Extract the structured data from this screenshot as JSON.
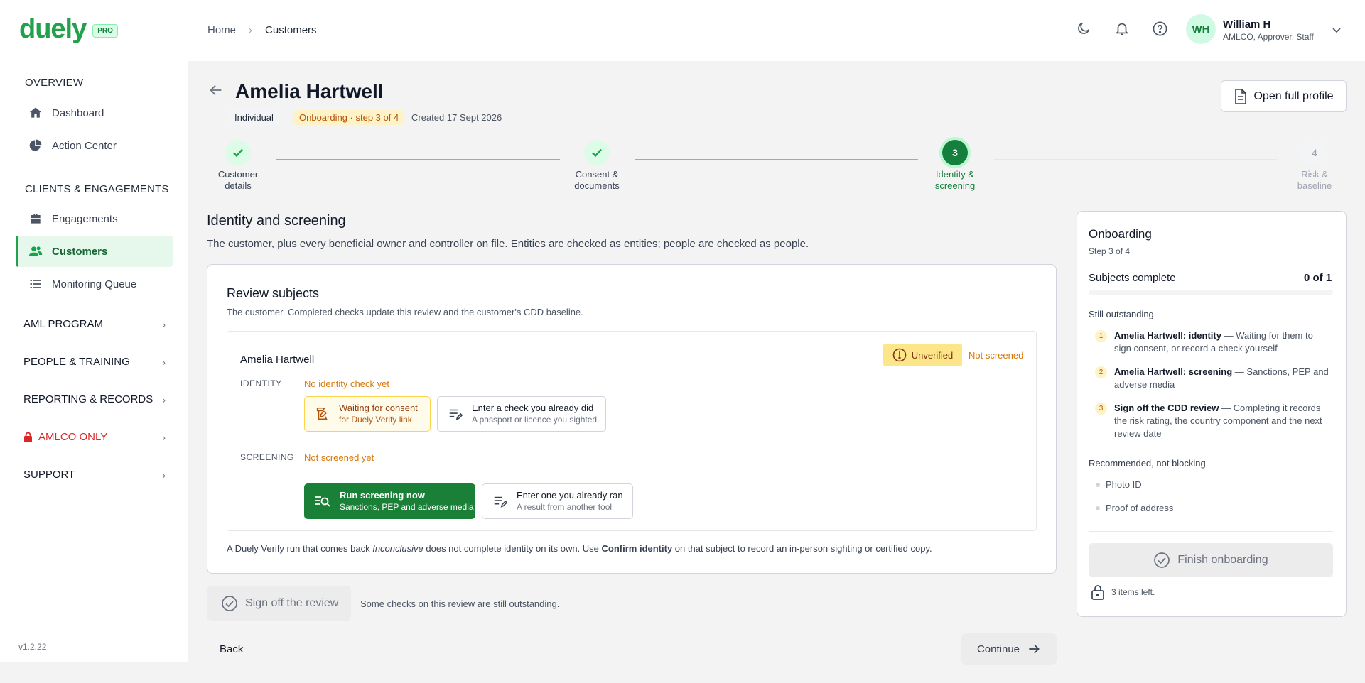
{
  "app": {
    "logo": "duely",
    "badge": "PRO",
    "version": "v1.2.22"
  },
  "sidebar": {
    "overview_title": "OVERVIEW",
    "overview_items": [
      {
        "label": "Dashboard",
        "icon": "home-icon"
      },
      {
        "label": "Action Center",
        "icon": "pie-chart-icon"
      }
    ],
    "clients_title": "CLIENTS & ENGAGEMENTS",
    "clients_items": [
      {
        "label": "Engagements",
        "icon": "briefcase-icon"
      },
      {
        "label": "Customers",
        "icon": "users-icon"
      },
      {
        "label": "Monitoring Queue",
        "icon": "checklist-icon"
      }
    ],
    "groups": [
      {
        "label": "AML PROGRAM"
      },
      {
        "label": "PEOPLE & TRAINING"
      },
      {
        "label": "REPORTING & RECORDS"
      },
      {
        "label": "AMLCO ONLY"
      },
      {
        "label": "SUPPORT"
      }
    ]
  },
  "header": {
    "breadcrumb": [
      "Home",
      "Customers"
    ],
    "user": {
      "initials": "WH",
      "name": "William H",
      "role": "AMLCO, Approver, Staff"
    }
  },
  "customer": {
    "name": "Amelia Hartwell",
    "type": "Individual",
    "status": "Onboarding · step 3 of 4",
    "created": "Created 17 Sept 2026",
    "open_profile": "Open full profile"
  },
  "stepper": [
    {
      "num": "1",
      "line1": "Customer",
      "line2": "details",
      "state": "done"
    },
    {
      "num": "2",
      "line1": "Consent &",
      "line2": "documents",
      "state": "done"
    },
    {
      "num": "3",
      "line1": "Identity &",
      "line2": "screening",
      "state": "current"
    },
    {
      "num": "4",
      "line1": "Risk &",
      "line2": "baseline",
      "state": "upcoming"
    }
  ],
  "section": {
    "title": "Identity and screening",
    "description": "The customer, plus every beneficial owner and controller on file. Entities are checked as entities; people are checked as people."
  },
  "review": {
    "title": "Review subjects",
    "description": "The customer. Completed checks update this review and the customer's CDD baseline.",
    "subject": {
      "name": "Amelia Hartwell",
      "badge": "Unverified",
      "screen_status": "Not screened"
    },
    "identity": {
      "label": "IDENTITY",
      "status": "No identity check yet",
      "consent_title": "Waiting for consent",
      "consent_sub": "for Duely Verify link",
      "enter_title": "Enter a check you already did",
      "enter_sub": "A passport or licence you sighted"
    },
    "screening": {
      "label": "SCREENING",
      "status": "Not screened yet",
      "run_title": "Run screening now",
      "run_sub": "Sanctions, PEP and adverse media",
      "enter_title": "Enter one you already ran",
      "enter_sub": "A result from another tool"
    },
    "footnote_a": "A Duely Verify run that comes back ",
    "footnote_b": "Inconclusive",
    "footnote_c": " does not complete identity on its own. Use ",
    "footnote_d": "Confirm identity",
    "footnote_e": " on that subject to record an in-person sighting or certified copy."
  },
  "signoff": {
    "button": "Sign off the review",
    "note": "Some checks on this review are still outstanding."
  },
  "footer": {
    "back": "Back",
    "continue": "Continue"
  },
  "panel": {
    "title": "Onboarding",
    "step": "Step 3 of 4",
    "progress_label": "Subjects complete",
    "progress_value": "0 of 1",
    "progress_fraction": 0,
    "outstanding_title": "Still outstanding",
    "outstanding": [
      {
        "num": "1",
        "bold": "Amelia Hartwell: identity",
        "rest": " — Waiting for them to sign consent, or record a check yourself"
      },
      {
        "num": "2",
        "bold": "Amelia Hartwell: screening",
        "rest": " — Sanctions, PEP and adverse media"
      },
      {
        "num": "3",
        "bold": "Sign off the CDD review",
        "rest": " — Completing it records the risk rating, the country component and the next review date"
      }
    ],
    "recommended_title": "Recommended, not blocking",
    "recommended": [
      "Photo ID",
      "Proof of address"
    ],
    "finish": "Finish onboarding",
    "items_left": "3 items left."
  },
  "colors": {
    "brand": "#22a04b",
    "warning": "#d97706",
    "danger": "#dc2626",
    "primary_button": "#15803d"
  }
}
